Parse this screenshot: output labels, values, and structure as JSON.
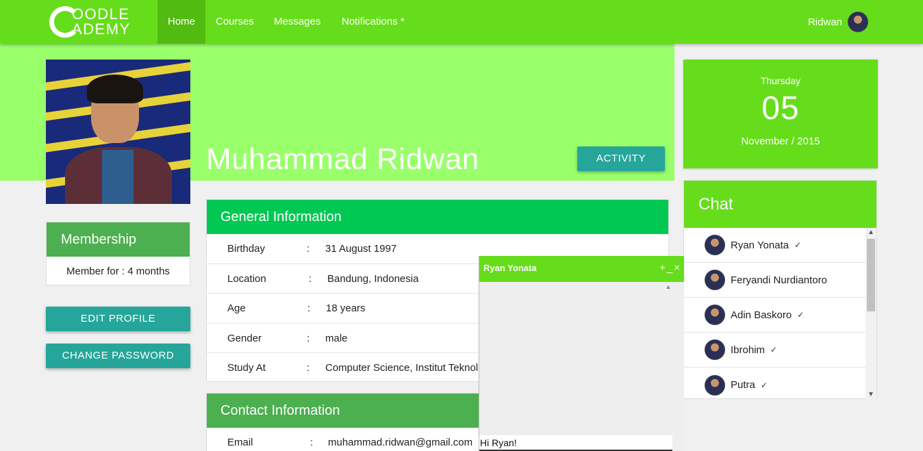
{
  "nav": {
    "logo_line1": "OODLE",
    "logo_line2": "ADEMY",
    "items": [
      {
        "label": "Home",
        "active": true
      },
      {
        "label": "Courses"
      },
      {
        "label": "Messages"
      },
      {
        "label": "Notifications *"
      }
    ],
    "user": "Ridwan"
  },
  "profile": {
    "name": "Muhammad Ridwan",
    "activity_button": "ACTIVITY"
  },
  "membership": {
    "title": "Membership",
    "text": "Member for : 4 months"
  },
  "buttons": {
    "edit_profile": "EDIT PROFILE",
    "change_password": "CHANGE PASSWORD"
  },
  "general": {
    "title": "General Information",
    "rows": [
      {
        "label": "Birthday",
        "sep": ":",
        "value": "31 August 1997"
      },
      {
        "label": "Location",
        "sep": ":",
        "value": "Bandung, Indonesia"
      },
      {
        "label": "Age",
        "sep": ":",
        "value": "18 years"
      },
      {
        "label": "Gender",
        "sep": ":",
        "value": "male"
      },
      {
        "label": "Study At",
        "sep": ":",
        "value": "Computer Science, Institut Teknol"
      }
    ]
  },
  "contact": {
    "title": "Contact Information",
    "rows": [
      {
        "label": "Email",
        "sep": ":",
        "value": "muhammad.ridwan@gmail.com"
      }
    ]
  },
  "chat_popup": {
    "title": "Ryan Yonata",
    "controls": "+_×",
    "input_value": "Hi Ryan!"
  },
  "date": {
    "day": "Thursday",
    "number": "05",
    "month_year": "November / 2015"
  },
  "chat": {
    "title": "Chat",
    "contacts": [
      {
        "name": "Ryan Yonata",
        "check": "✓"
      },
      {
        "name": "Feryandi Nurdiantoro",
        "check": ""
      },
      {
        "name": "Adin Baskoro",
        "check": "✓"
      },
      {
        "name": "Ibrohim",
        "check": "✓"
      },
      {
        "name": "Putra",
        "check": "✓"
      }
    ]
  },
  "colors": {
    "nav_green": "#66dd1a",
    "banner_green": "#99ff6a",
    "card_green": "#00c853",
    "membership_green": "#4caf50",
    "teal_button": "#26a69a"
  }
}
